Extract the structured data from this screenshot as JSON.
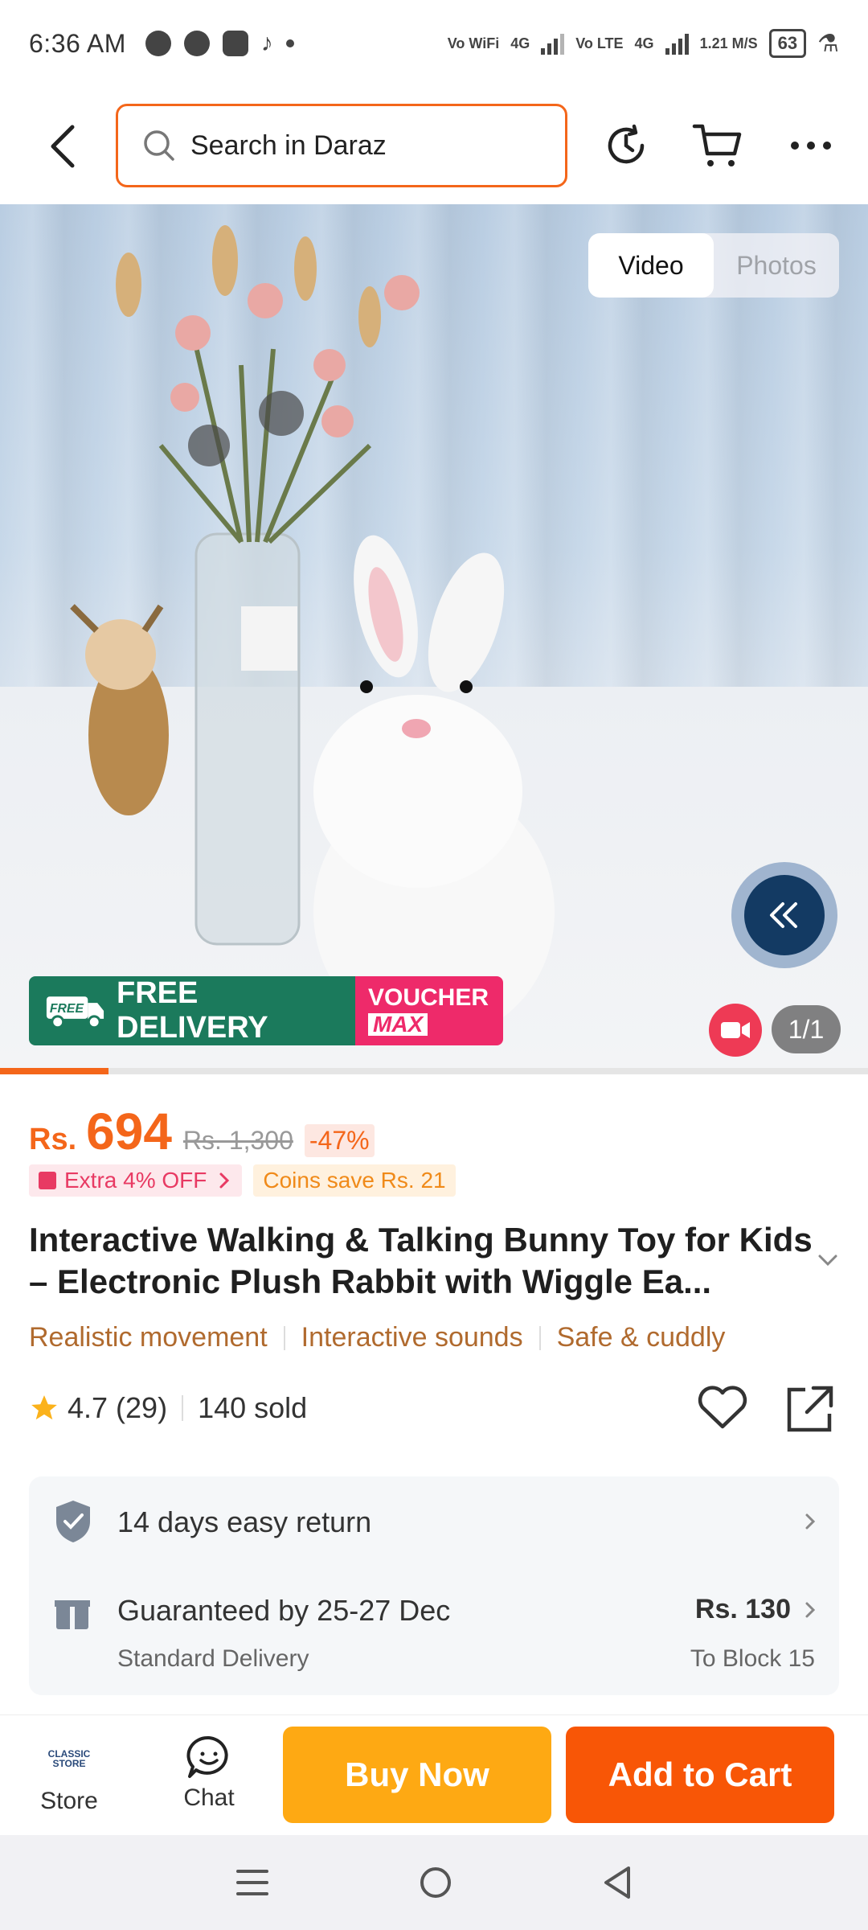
{
  "status_bar": {
    "time": "6:36 AM",
    "net1": "Vo WiFi",
    "g1": "4G",
    "net2": "Vo LTE",
    "g2": "4G",
    "speed": "1.21 M/S",
    "battery": "63"
  },
  "header": {
    "search_placeholder": "Search in Daraz"
  },
  "media": {
    "tabs": [
      "Video",
      "Photos"
    ],
    "active_tab": "Video",
    "counter": "1/1",
    "promo_free": "FREE DELIVERY",
    "promo_free_badge": "FREE",
    "promo_voucher_line1": "VOUCHER",
    "promo_voucher_line2": "MAX",
    "progress": 0.125
  },
  "price": {
    "currency": "Rs.",
    "amount": "694",
    "original": "Rs. 1,300",
    "discount": "-47%"
  },
  "tags": {
    "extra_off": "Extra 4% OFF",
    "coins": "Coins save Rs. 21"
  },
  "product": {
    "title": "Interactive Walking & Talking Bunny Toy for Kids – Electronic Plush Rabbit with Wiggle Ea...",
    "features": [
      "Realistic movement",
      "Interactive sounds",
      "Safe & cuddly"
    ],
    "rating": "4.7",
    "reviews": "(29)",
    "sold": "140 sold"
  },
  "service": {
    "return_label": "14 days easy return",
    "delivery_label": "Guaranteed by 25-27 Dec",
    "delivery_sub": "Standard Delivery",
    "delivery_price": "Rs. 130",
    "delivery_to": "To Block 15"
  },
  "bottom_bar": {
    "store_label": "Store",
    "store_logo_text": "CLASSIC STORE",
    "chat_label": "Chat",
    "buy_now": "Buy Now",
    "add_to_cart": "Add to Cart"
  },
  "colors": {
    "accent": "#f85606",
    "buy_now": "#fea913",
    "price": "#f4661a"
  }
}
